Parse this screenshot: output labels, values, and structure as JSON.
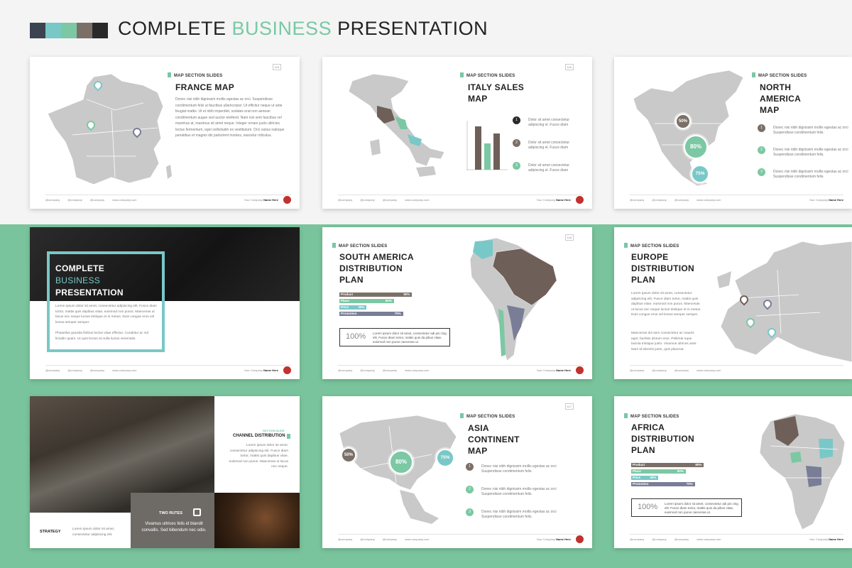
{
  "header": {
    "title_part1": "COMPLETE ",
    "title_accent": "BUSINESS",
    "title_part2": " PRESENTATION",
    "palette": [
      "#3b4450",
      "#79c8c8",
      "#7cc8a4",
      "#7b7068",
      "#2a2a2a"
    ]
  },
  "common": {
    "section_label": "MAP SECTION SLIDES",
    "social": [
      "@company",
      "@company",
      "@company",
      "www.company.com"
    ],
    "company_prefix": "Your Company",
    "company_name": "Name Here"
  },
  "france": {
    "page": "115",
    "title": "FRANCE MAP",
    "body": "Donec nisi nibh dignissim mollis egestas ac orci. Suspendisse condimentum felis ut fauctbus ullamcorper. Ut efficitur neque ut ante feugiat mattis. Ut et nibh imperdiet, sodales erat non aenean condimentum augue sed auctor eleifend. Nam nisi sem faucibus vel maximus at, maximus sit amet neque. Integer ornare justo ultricies lectus fermentum, eget sollicitudin ex vestibulum. Orci varius natoque penatibus et magnis dis parturient montes, nascetur ridiculus."
  },
  "italy": {
    "page": "116",
    "title_line1": "ITALY SALES",
    "title_line2": "MAP",
    "items": [
      {
        "num": "1",
        "text": "Dolor sit amet consectetur adipiscing el. Fusce diam",
        "color": "#2a2a2a"
      },
      {
        "num": "2",
        "text": "Dolor sit amet consectetur adipiscing el. Fusce diam",
        "color": "#7b7068"
      },
      {
        "num": "3",
        "text": "Dolor sit amet consectetur adipiscing el. Fusce diam",
        "color": "#7cc8a4"
      }
    ]
  },
  "north_america": {
    "title_line1": "NORTH",
    "title_line2": "AMERICA",
    "title_line3": "MAP",
    "bubbles": [
      "50%",
      "80%",
      "75%"
    ],
    "items": [
      {
        "num": "1",
        "text": "Donec nisi nibh dignissim mollis egestas ac orci Suspendisse condimentum felis.",
        "color": "#7b7068"
      },
      {
        "num": "2",
        "text": "Donec nisi nibh dignissim mollis egestas ac orci Suspendisse condimentum felis.",
        "color": "#7cc8a4"
      },
      {
        "num": "3",
        "text": "Donec nisi nibh dignissim mollis egestas ac orci Suspendisse condimentum felis.",
        "color": "#7cc8a4"
      }
    ]
  },
  "cover": {
    "line1": "COMPLETE",
    "line2": "BUSINESS",
    "line3": "PRESENTATION",
    "para1": "Lorem ipsum dolor sit amet, consectetur adipiscing elit. Fusce diam tortor, mattis quis dapibus vitae, euismod non purus. Maecenas ut lacus nec neque luctus tristique et in metus. Duis congue eros vel lectus semper semper.",
    "para2": "Phasellus gravida finibus lectus vitae efficitur. Curabitur ac sol lictudin quam. Ut quis lectus at nulla luctus venenatis."
  },
  "south_america": {
    "page": "118",
    "title_line1": "SOUTH AMERICA",
    "title_line2": "DISTRIBUTION",
    "title_line3": "PLAN",
    "bars": [
      {
        "label": "Product",
        "value": 80,
        "pct": "80%",
        "color": "#7b7068"
      },
      {
        "label": "Place",
        "value": 60,
        "pct": "60%",
        "color": "#7cc8a4"
      },
      {
        "label": "Price",
        "value": 30,
        "pct": "30%",
        "color": "#79c8c8"
      },
      {
        "label": "Promotion",
        "value": 70,
        "pct": "70%",
        "color": "#7a7d96"
      }
    ],
    "box_big": "100%",
    "box_text": "Lorem ipsum dolor sit amet, consectetur adi pis cing elit. Fusce diam tortor, mattis quis da pibus vitae, euismod non purus caecenas ut."
  },
  "europe": {
    "title_line1": "EUROPE",
    "title_line2": "DISTRIBUTION",
    "title_line3": "PLAN",
    "para1": "Lorem ipsum dolor sit amet, consectetur adipiscing elit. Fusce diam tortor, mattis quis dapibus vitae, euismod non purus. Maecenas ut lacus nec neque luctus tristique et in metus. Duis congue eros vel lectus semper semper.",
    "para2": "Maecenas dui sem consectetur ac mauris eget, facilisis dictum eros. Pellente sque lacinia tristique justo. Vivamus ultrices ante. Nam id lobortis justo, quis placerat."
  },
  "channel": {
    "section": "SECTION SLIDE",
    "title": "CHANNEL DISTRIBUTION",
    "body": "Lorem ipsum dolor sit amet, consectetur adipiscing elit. Fusce diam tortor, mattis quis dapibus vitae, euismod non purus. Maecenas ut lacus nec neque.",
    "two_rutes": "TWO RUTES",
    "two_rutes_text": "Vivamus ultrices felis id blandit convallis. Sed bibendum nec odio.",
    "strategy": "STRATEGY",
    "strategy_text": "Lorem ipsum dolor sit amet, consectetur adipiscing elit."
  },
  "asia": {
    "page": "117",
    "title_line1": "ASIA",
    "title_line2": "CONTINENT",
    "title_line3": "MAP",
    "bubbles": [
      "50%",
      "80%",
      "75%"
    ],
    "items": [
      {
        "num": "1",
        "text": "Donec nisi nibh dignissim mollis egestas ac orci Suspendisse condimentum felis.",
        "color": "#7b7068"
      },
      {
        "num": "2",
        "text": "Donec nisi nibh dignissim mollis egestas ac orci Suspendisse condimentum felis.",
        "color": "#7cc8a4"
      },
      {
        "num": "3",
        "text": "Donec nisi nibh dignissim mollis egestas ac orci Suspendisse condimentum felis.",
        "color": "#7cc8a4"
      }
    ]
  },
  "africa": {
    "title_line1": "AFRICA",
    "title_line2": "DISTRIBUTION",
    "title_line3": "PLAN",
    "bars": [
      {
        "label": "Product",
        "value": 80,
        "pct": "80%",
        "color": "#7b7068"
      },
      {
        "label": "Place",
        "value": 60,
        "pct": "60%",
        "color": "#7cc8a4"
      },
      {
        "label": "Price",
        "value": 30,
        "pct": "30%",
        "color": "#79c8c8"
      },
      {
        "label": "Promotion",
        "value": 70,
        "pct": "70%",
        "color": "#7a7d96"
      }
    ],
    "box_big": "100%",
    "box_text": "Lorem ipsum dolor sit amet, consectetur adi pis cing elit. Fusce diam tortor, mattis quis da pibus vitae, euismod non purus caecenas ut."
  }
}
